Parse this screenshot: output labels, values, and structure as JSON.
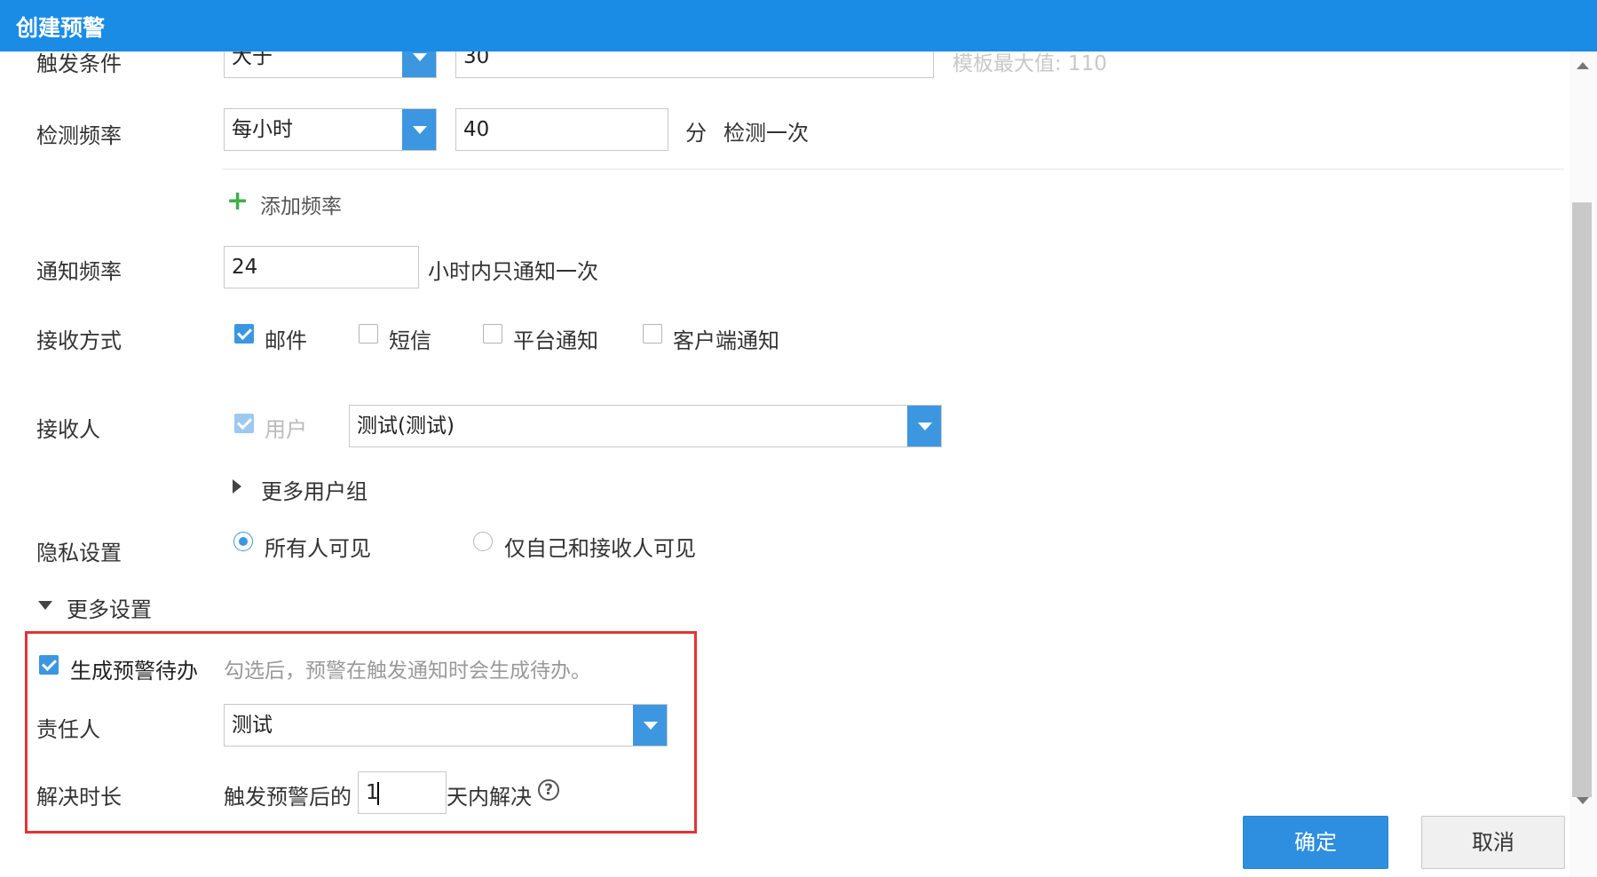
{
  "window": {
    "title": "创建预警"
  },
  "form": {
    "trigger": {
      "label": "触发条件",
      "operator": "大于",
      "value": "30",
      "hint": "模板最大值: 110"
    },
    "detect_freq": {
      "label": "检测频率",
      "period": "每小时",
      "value": "40",
      "unit": "分",
      "suffix": "检测一次",
      "add_label": "添加频率"
    },
    "notify_freq": {
      "label": "通知频率",
      "value": "24",
      "suffix": "小时内只通知一次"
    },
    "receive_method": {
      "label": "接收方式",
      "options": [
        {
          "label": "邮件",
          "checked": true
        },
        {
          "label": "短信",
          "checked": false
        },
        {
          "label": "平台通知",
          "checked": false
        },
        {
          "label": "客户端通知",
          "checked": false
        }
      ]
    },
    "receiver": {
      "label": "接收人",
      "user_label": "用户",
      "user_value": "测试(测试)",
      "more_groups": "更多用户组"
    },
    "privacy": {
      "label": "隐私设置",
      "options": [
        {
          "label": "所有人可见",
          "checked": true
        },
        {
          "label": "仅自己和接收人可见",
          "checked": false
        }
      ]
    },
    "more_settings": {
      "label": "更多设置",
      "gen_todo": {
        "label": "生成预警待办",
        "checked": true,
        "hint": "勾选后，预警在触发通知时会生成待办。"
      },
      "owner": {
        "label": "责任人",
        "value": "测试"
      },
      "resolve": {
        "label": "解决时长",
        "prefix": "触发预警后的",
        "value": "1",
        "suffix": "天内解决"
      }
    }
  },
  "buttons": {
    "ok": "确定",
    "cancel": "取消"
  },
  "colors": {
    "accent": "#1a8ce6",
    "highlight": "#e03434"
  }
}
